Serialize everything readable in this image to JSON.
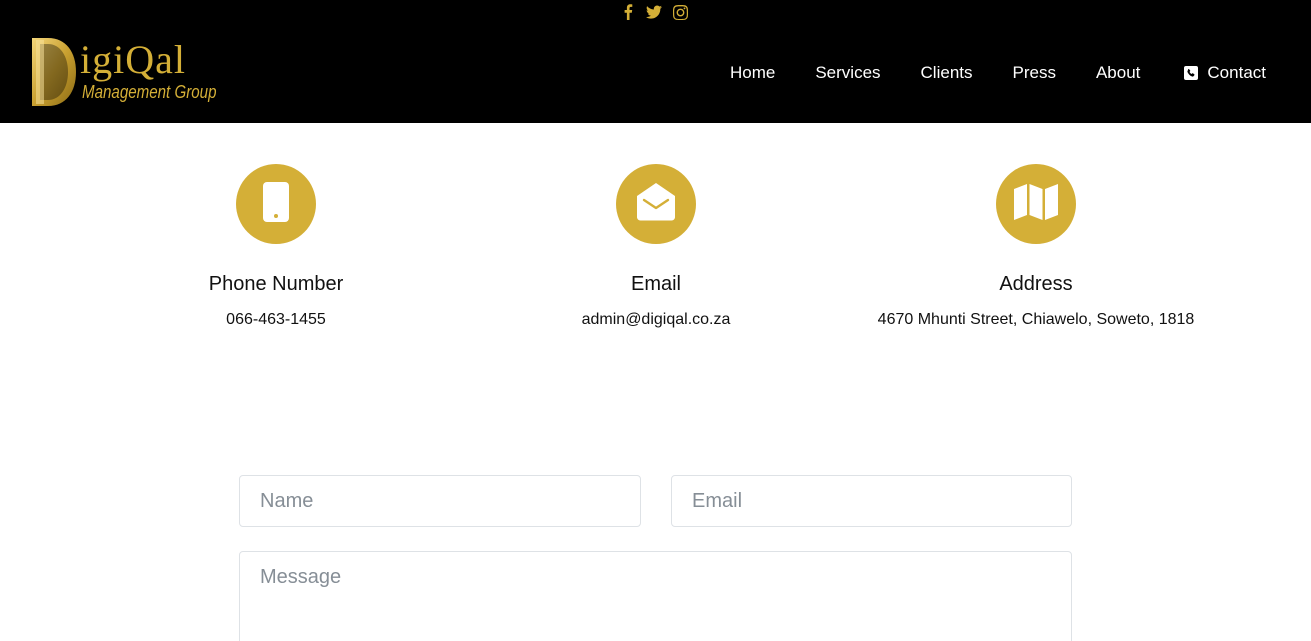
{
  "header": {
    "social": {
      "facebook_icon": "facebook-icon",
      "twitter_icon": "twitter-icon",
      "instagram_icon": "instagram-icon"
    },
    "logo": {
      "wordmark": "igiQal",
      "subtitle": "Management Group"
    },
    "nav": {
      "items": [
        "Home",
        "Services",
        "Clients",
        "Press",
        "About"
      ],
      "contact_label": "Contact",
      "contact_icon": "phone-square-icon"
    }
  },
  "info": {
    "phone": {
      "icon": "mobile-phone-icon",
      "title": "Phone Number",
      "value": "066-463-1455"
    },
    "email": {
      "icon": "envelope-open-icon",
      "title": "Email",
      "value": "admin@digiqal.co.za"
    },
    "address": {
      "icon": "map-icon",
      "title": "Address",
      "value": "4670 Mhunti Street, Chiawelo, Soweto, 1818"
    }
  },
  "form": {
    "name_placeholder": "Name",
    "email_placeholder": "Email",
    "message_placeholder": "Message"
  },
  "colors": {
    "accent": "#d4af37",
    "header_bg": "#000000",
    "nav_text": "#ffffff"
  }
}
